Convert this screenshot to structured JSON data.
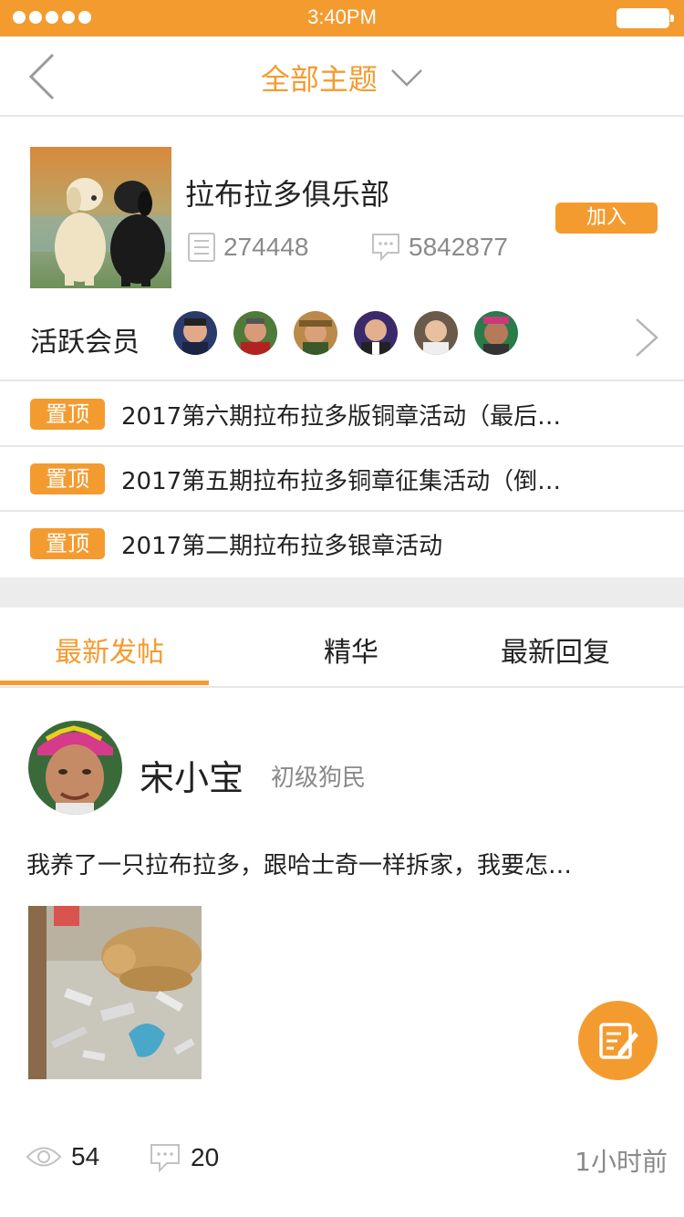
{
  "status_bar": {
    "time": "3:40PM"
  },
  "nav": {
    "title": "全部主题"
  },
  "club": {
    "name": "拉布拉多俱乐部",
    "posts_count": "274448",
    "replies_count": "5842877",
    "join_label": "加入",
    "members_label": "活跃会员"
  },
  "pinned": [
    {
      "badge": "置顶",
      "title": "2017第六期拉布拉多版铜章活动（最后…"
    },
    {
      "badge": "置顶",
      "title": "2017第五期拉布拉多铜章征集活动（倒…"
    },
    {
      "badge": "置顶",
      "title": "2017第二期拉布拉多银章活动"
    }
  ],
  "tabs": {
    "latest": "最新发帖",
    "best": "精华",
    "reply": "最新回复"
  },
  "post": {
    "author": "宋小宝",
    "level": "初级狗民",
    "text": "我养了一只拉布拉多，跟哈士奇一样拆家，我要怎…",
    "views": "54",
    "comments": "20",
    "time": "1小时前"
  },
  "colors": {
    "accent": "#f49b30",
    "divider": "#e6e6e6",
    "muted": "#8a8a8a"
  }
}
